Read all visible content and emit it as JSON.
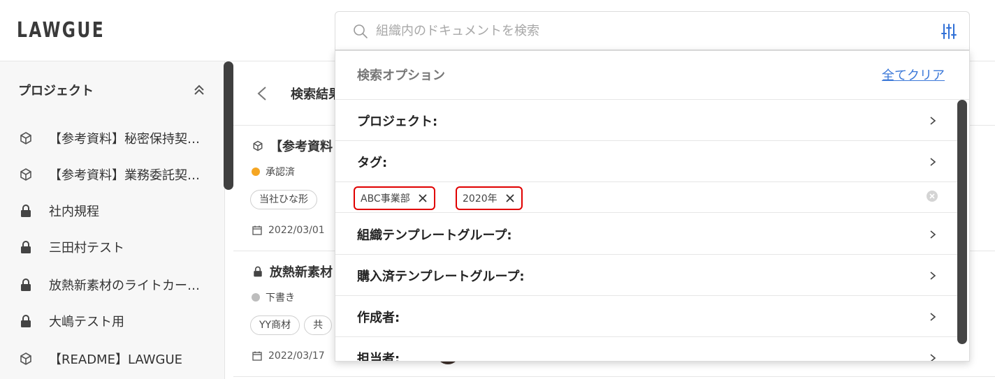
{
  "header": {
    "logo": "LAWGUE",
    "search_placeholder": "組織内のドキュメントを検索"
  },
  "sidebar": {
    "title": "プロジェクト",
    "items": [
      {
        "label": "【参考資料】秘密保持契約書",
        "icon": "cube-icon"
      },
      {
        "label": "【参考資料】業務委託契約書",
        "icon": "cube-icon"
      },
      {
        "label": "社内規程",
        "icon": "lock-icon"
      },
      {
        "label": "三田村テスト",
        "icon": "lock-icon"
      },
      {
        "label": "放熱新素材のライトカーボン",
        "icon": "lock-icon"
      },
      {
        "label": "大嶋テスト用",
        "icon": "lock-icon"
      },
      {
        "label": "【README】LAWGUE",
        "icon": "cube-icon"
      }
    ]
  },
  "main": {
    "title": "検索結果",
    "results": [
      {
        "title": "【参考資料",
        "icon": "cube-icon",
        "status": "承認済",
        "status_color": "#f5a623",
        "tags": [
          "当社ひな形"
        ],
        "date": "2022/03/01"
      },
      {
        "title": "放熱新素材",
        "icon": "lock-icon",
        "status": "下書き",
        "status_color": "#bdbdbd",
        "tags": [
          "YY商材",
          "共"
        ],
        "date": "2022/03/17"
      }
    ]
  },
  "search_options": {
    "title": "検索オプション",
    "clear_all": "全てクリア",
    "rows": {
      "project": "プロジェクト:",
      "tag": "タグ:",
      "org_template": "組織テンプレートグループ:",
      "purchased_template": "購入済テンプレートグループ:",
      "author": "作成者:",
      "assignee": "担当者:"
    },
    "selected_tags": [
      "ABC事業部",
      "2020年"
    ]
  },
  "colors": {
    "accent": "#3b78d8",
    "highlight": "#e00000"
  }
}
